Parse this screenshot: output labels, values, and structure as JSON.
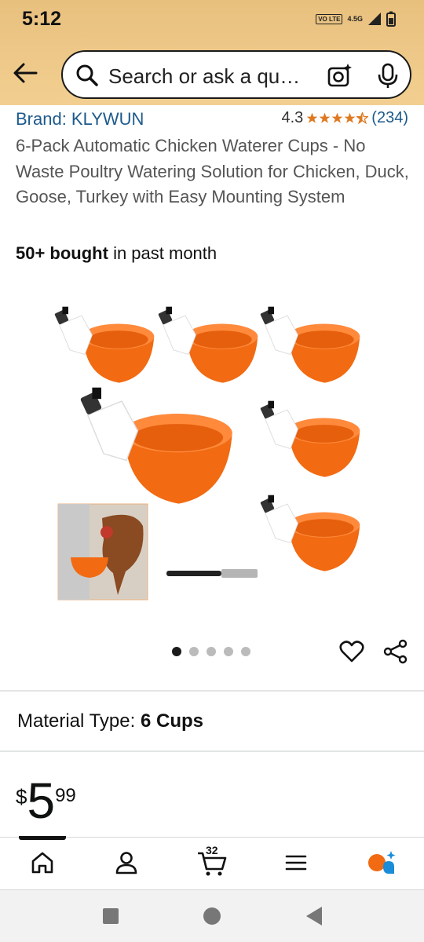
{
  "status": {
    "time": "5:12",
    "volte": "VO LTE",
    "network": "4.5G"
  },
  "search": {
    "placeholder": "Search or ask a qu…"
  },
  "product": {
    "brand": "Brand: KLYWUN",
    "rating": "4.3",
    "rating_count": "(234)",
    "stars": 4.3,
    "title": "6-Pack Automatic Chicken Waterer Cups - No Waste Poultry Watering Solution for Chicken, Duck, Goose, Turkey with Easy Mounting System",
    "bought_bold": "50+ bought",
    "bought_rest": " in past month",
    "image_count": 5,
    "active_image": 0
  },
  "material": {
    "label": "Material Type:",
    "value": "6 Cups"
  },
  "price": {
    "symbol": "$",
    "whole": "5",
    "fraction": "99"
  },
  "nav": {
    "cart_count": "32"
  },
  "colors": {
    "accent_bar": "#f2cf91",
    "link": "#1d5a8c",
    "star": "#de7921",
    "cup": "#f26a12"
  }
}
